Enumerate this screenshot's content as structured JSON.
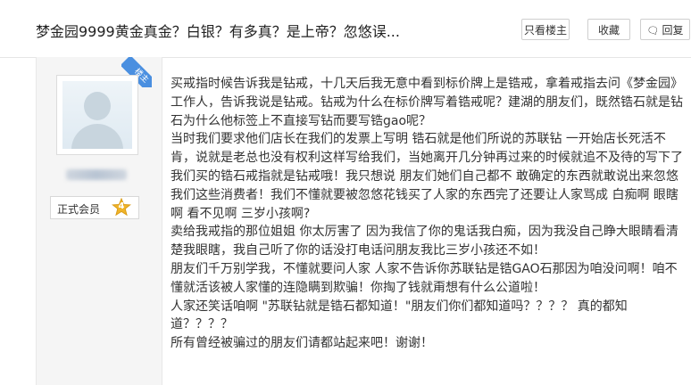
{
  "thread": {
    "title": "梦金园9999黄金真金？白银？有多真？是上帝？忽悠误..."
  },
  "toolbar": {
    "only_op_label": "只看楼主",
    "favorite_label": "收藏",
    "reply_label": "回复",
    "reply_icon": "comment-icon"
  },
  "author": {
    "op_badge": "楼主",
    "avatar_icon": "default-avatar-icon",
    "rank_label": "正式会员",
    "rank_level": "4"
  },
  "post": {
    "paragraphs": [
      "买戒指时候告诉我是钻戒，十几天后我无意中看到标价牌上是锆戒，拿着戒指去问《梦金园》工作人，告诉我说是钻戒。钻戒为什么在标价牌写着锆戒呢？建湖的朋友们，既然锆石就是钻石为什么他标签上不直接写钻而要写锆gao呢？",
      "当时我们要求他们店长在我们的发票上写明 锆石就是他们所说的苏联钻 一开始店长死活不肯，说就是老总也没有权利这样写给我们，当她离开几分钟再过来的时候就追不及待的写下了我们买的锆石戒指就是钻戒哦！我只想说 朋友们她们自己都不 敢确定的东西就敢说出来忽悠我们这些消费者！我们不懂就要被忽悠花钱买了人家的东西完了还要让人家骂成 白痴啊 眼瞎啊 看不见啊 三岁小孩啊?",
      "卖给我戒指的那位姐姐 你太厉害了 因为我信了你的鬼话我白痴，因为我没自己睁大眼睛看清楚我眼瞎，我自己听了你的话没打电话问朋友我比三岁小孩还不如！",
      "朋友们千万别学我，不懂就要问人家 人家不告诉你苏联钻是锆GAO石那因为咱没问啊！咱不懂就活该被人家懂的连隐瞒到欺骗！你掏了钱就甭想有什么公道啦！",
      "人家还笑话咱啊 \"苏联钻就是锆石都知道！\"朋友们你们都知道吗？？？？ 真的都知道？？？？",
      "所有曾经被骗过的朋友们请都站起来吧！谢谢！"
    ]
  }
}
